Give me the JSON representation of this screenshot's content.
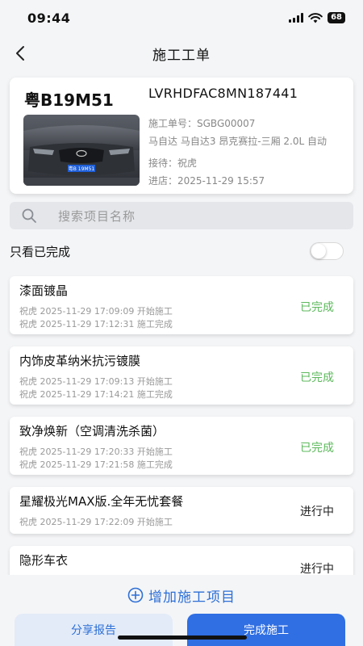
{
  "status_bar": {
    "time": "09:44",
    "battery": "68"
  },
  "nav": {
    "title": "施工工单"
  },
  "vehicle": {
    "plate": "粤B19M51",
    "vin": "LVRHDFAC8MN187441",
    "order_no": "施工单号：SGBG00007",
    "model": "马自达 马自达3 昂克赛拉-三厢 2.0L 自动",
    "receptionist": "接待：祝虎",
    "entry_time": "进店：2025-11-29 15:57",
    "photo_plate": "粤B 19M51"
  },
  "search": {
    "placeholder": "搜索项目名称"
  },
  "filter": {
    "label": "只看已完成",
    "on": false
  },
  "tasks": [
    {
      "name": "漆面镀晶",
      "log1": "祝虎  2025-11-29 17:09:09 开始施工",
      "log2": "祝虎  2025-11-29 17:12:31 施工完成",
      "status": "已完成"
    },
    {
      "name": "内饰皮革纳米抗污镀膜",
      "log1": "祝虎  2025-11-29 17:09:13 开始施工",
      "log2": "祝虎  2025-11-29 17:14:21 施工完成",
      "status": "已完成"
    },
    {
      "name": "致净焕新（空调清洗杀菌）",
      "log1": "祝虎  2025-11-29 17:20:33 开始施工",
      "log2": "祝虎  2025-11-29 17:21:58 施工完成",
      "status": "已完成"
    },
    {
      "name": "星耀极光MAX版.全年无忧套餐",
      "log1": "祝虎  2025-11-29 17:22:09 开始施工",
      "status": "进行中"
    },
    {
      "name": "隐形车衣",
      "status": "进行中"
    }
  ],
  "actions": {
    "add_item": "增加施工项目",
    "share_report": "分享报告",
    "finish": "完成施工"
  },
  "colors": {
    "accent": "#2f6ee3",
    "done": "#5cb85c"
  }
}
